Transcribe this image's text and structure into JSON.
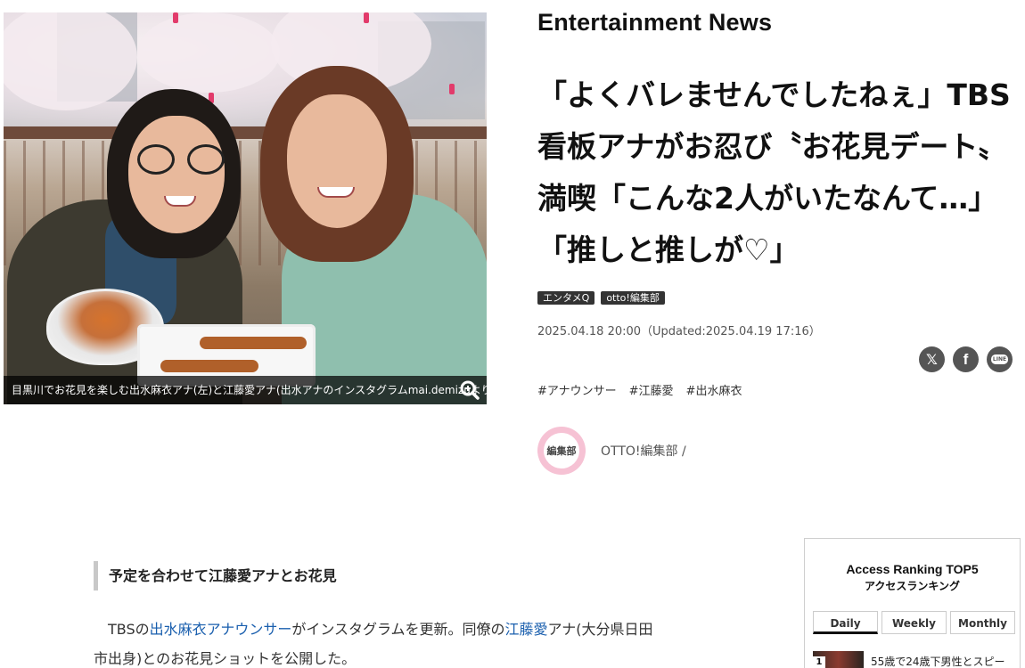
{
  "article": {
    "section": "Entertainment News",
    "headline": "「よくバレませんでしたねぇ」TBS看板アナがお忍び〝お花見デート〟満喫「こんな2人がいたなんて…」「推しと推しが♡」",
    "tags": [
      "エンタメQ",
      "otto!編集部"
    ],
    "dateline": "2025.04.18 20:00（Updated:2025.04.19 17:16）",
    "hashtags": [
      "#アナウンサー",
      "#江藤愛",
      "#出水麻衣"
    ],
    "author": {
      "avatar_text": "編集部",
      "name": "OTTO!編集部 /"
    },
    "photo_caption": "目黒川でお花見を楽しむ出水麻衣アナ(左)と江藤愛アナ(出水アナのインスタグラムmai.demizuより)"
  },
  "body": {
    "subheading": "予定を合わせて江藤愛アナとお花見",
    "p1_prefix": "TBSの",
    "p1_link1": "出水麻衣アナウンサー",
    "p1_mid": "がインスタグラムを更新。同僚の",
    "p1_link2": "江藤愛",
    "p1_suffix": "アナ(大分県日田市出身)とのお花見ショットを公開した。"
  },
  "share": {
    "icons": [
      "x-icon",
      "facebook-icon",
      "line-icon"
    ],
    "x_label": "𝕏",
    "facebook_label": "f",
    "line_label": "LINE"
  },
  "ranking": {
    "title": "Access Ranking TOP5",
    "subtitle": "アクセスランキング",
    "tabs": [
      "Daily",
      "Weekly",
      "Monthly"
    ],
    "active_tab": "Daily",
    "items": [
      {
        "rank": "1",
        "text": "55歳で24歳下男性とスピー"
      }
    ]
  },
  "colors": {
    "tag_bg": "#333333",
    "link": "#1a5fae",
    "share_bg": "#555555",
    "avatar_ring": "#f6c2d4"
  }
}
